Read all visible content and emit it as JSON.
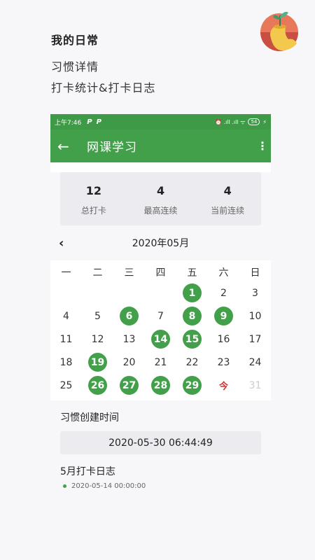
{
  "promo": {
    "title": "我的日常",
    "subtitle": "习惯详情",
    "subtitle2": "打卡统计&打卡日志"
  },
  "statusbar": {
    "time": "上午7:46",
    "p1": "P",
    "p2": "P",
    "signal": "⏰ .ıll .ıll ᯤ",
    "battery": "54",
    "charge": "⚡"
  },
  "toolbar": {
    "back": "←",
    "title": "网课学习",
    "more": "⋮"
  },
  "stats": [
    {
      "value": "12",
      "label": "总打卡"
    },
    {
      "value": "4",
      "label": "最高连续"
    },
    {
      "value": "4",
      "label": "当前连续"
    }
  ],
  "calendar": {
    "prev": "‹",
    "month_label": "2020年05月",
    "weekdays": [
      "一",
      "二",
      "三",
      "四",
      "五",
      "六",
      "日"
    ],
    "weeks": [
      [
        {
          "d": ""
        },
        {
          "d": ""
        },
        {
          "d": ""
        },
        {
          "d": ""
        },
        {
          "d": "1",
          "s": "checked"
        },
        {
          "d": "2"
        },
        {
          "d": "3"
        }
      ],
      [
        {
          "d": "4"
        },
        {
          "d": "5"
        },
        {
          "d": "6",
          "s": "checked"
        },
        {
          "d": "7"
        },
        {
          "d": "8",
          "s": "checked"
        },
        {
          "d": "9",
          "s": "checked"
        },
        {
          "d": "10"
        }
      ],
      [
        {
          "d": "11"
        },
        {
          "d": "12"
        },
        {
          "d": "13"
        },
        {
          "d": "14",
          "s": "checked"
        },
        {
          "d": "15",
          "s": "checked"
        },
        {
          "d": "16"
        },
        {
          "d": "17"
        }
      ],
      [
        {
          "d": "18"
        },
        {
          "d": "19",
          "s": "checked"
        },
        {
          "d": "20"
        },
        {
          "d": "21"
        },
        {
          "d": "22"
        },
        {
          "d": "23"
        },
        {
          "d": "24"
        }
      ],
      [
        {
          "d": "25"
        },
        {
          "d": "26",
          "s": "checked"
        },
        {
          "d": "27",
          "s": "checked"
        },
        {
          "d": "28",
          "s": "checked"
        },
        {
          "d": "29",
          "s": "checked"
        },
        {
          "d": "今",
          "s": "today"
        },
        {
          "d": "31",
          "s": "future"
        }
      ]
    ]
  },
  "created": {
    "label": "习惯创建时间",
    "value": "2020-05-30 06:44:49"
  },
  "log": {
    "title": "5月打卡日志",
    "items": [
      "2020-05-14 00:00:00"
    ]
  },
  "colors": {
    "primary": "#43a04a",
    "statusbar": "#3e9a47",
    "today": "#d32f2f"
  }
}
